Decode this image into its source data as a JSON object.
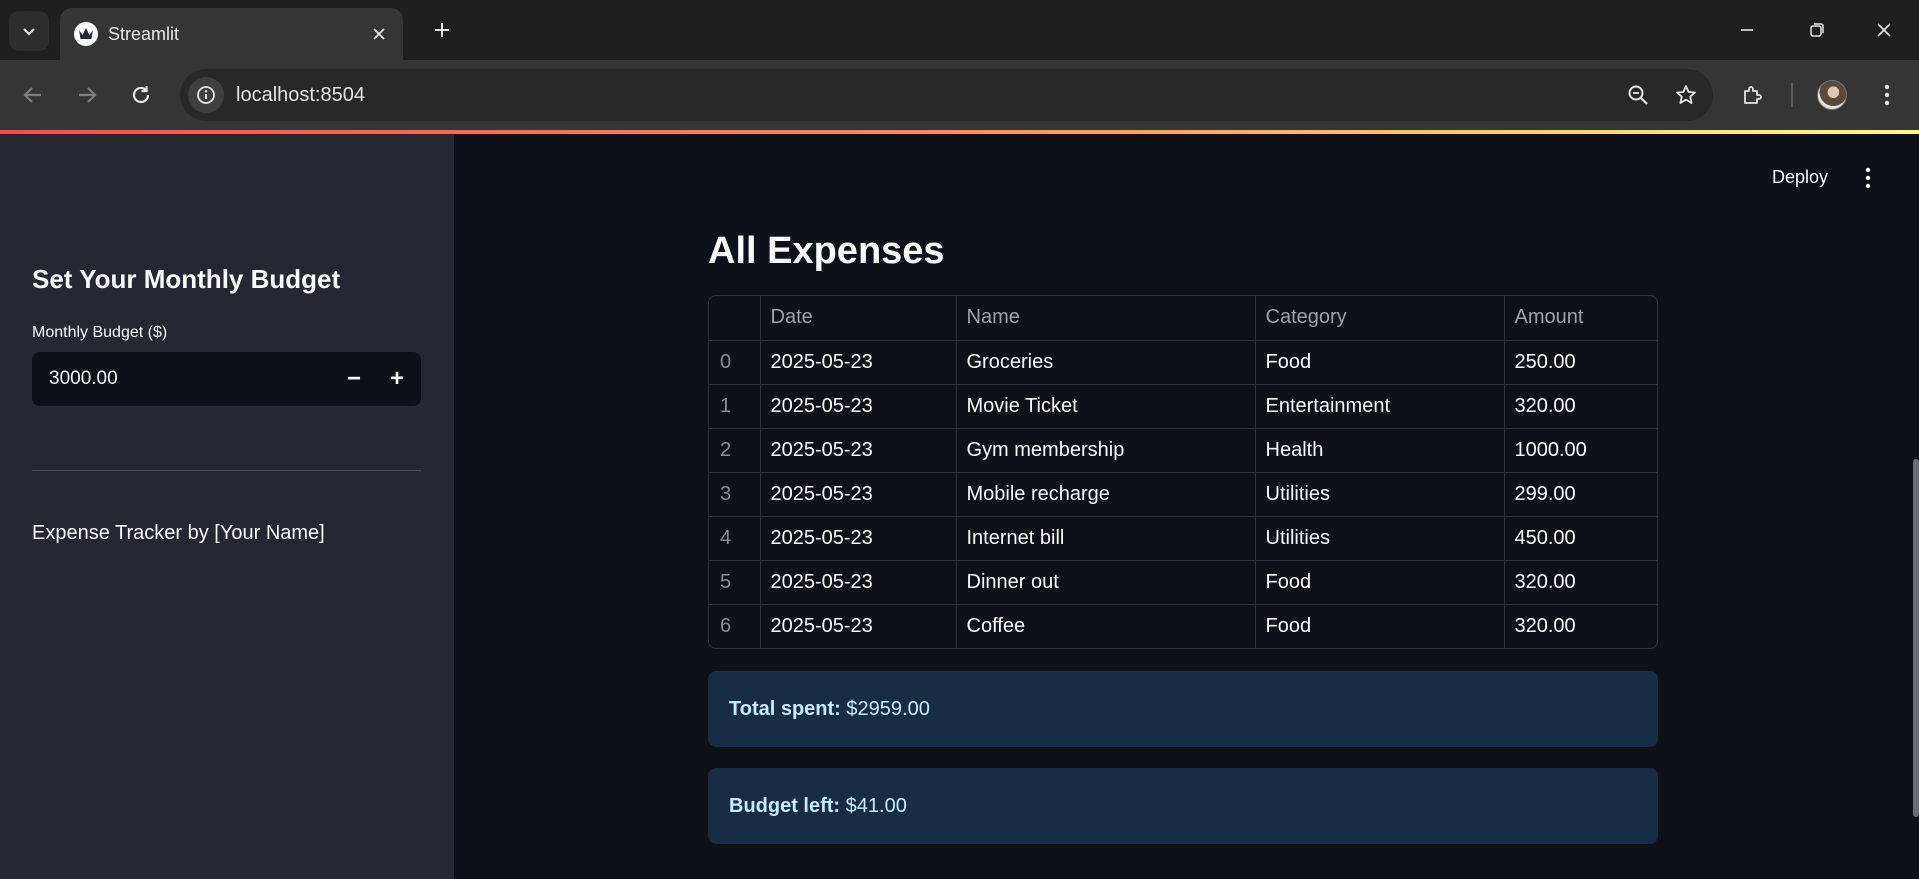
{
  "browser": {
    "tab_title": "Streamlit",
    "url": "localhost:8504"
  },
  "sidebar": {
    "title": "Set Your Monthly Budget",
    "budget_label": "Monthly Budget ($)",
    "budget_value": "3000.00",
    "minus_label": "−",
    "plus_label": "+",
    "footer": "Expense Tracker by [Your Name]"
  },
  "main": {
    "deploy_label": "Deploy",
    "title": "All Expenses",
    "table": {
      "columns": [
        "",
        "Date",
        "Name",
        "Category",
        "Amount"
      ],
      "rows": [
        [
          "0",
          "2025-05-23",
          "Groceries",
          "Food",
          "250.00"
        ],
        [
          "1",
          "2025-05-23",
          "Movie Ticket",
          "Entertainment",
          "320.00"
        ],
        [
          "2",
          "2025-05-23",
          "Gym membership",
          "Health",
          "1000.00"
        ],
        [
          "3",
          "2025-05-23",
          "Mobile recharge",
          "Utilities",
          "299.00"
        ],
        [
          "4",
          "2025-05-23",
          "Internet bill",
          "Utilities",
          "450.00"
        ],
        [
          "5",
          "2025-05-23",
          "Dinner out",
          "Food",
          "320.00"
        ],
        [
          "6",
          "2025-05-23",
          "Coffee",
          "Food",
          "320.00"
        ]
      ]
    },
    "total_label": "Total spent:",
    "total_value": " $2959.00",
    "budget_left_label": "Budget left:",
    "budget_left_value": " $41.00"
  },
  "colors": {
    "accent": "#ff4b4b",
    "info_bg": "#172d43",
    "info_text": "#c7ebff",
    "sidebar_bg": "#262730",
    "main_bg": "#0e1117"
  }
}
